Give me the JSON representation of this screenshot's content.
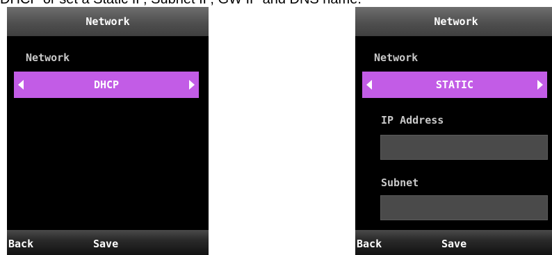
{
  "caption": "DHCP  or set a Static IP, Subnet IP, GW IP and DNS name.",
  "left_screen": {
    "title": "Network",
    "network_label": "Network",
    "mode_value": "DHCP",
    "back_label": "Back",
    "save_label": "Save"
  },
  "right_screen": {
    "title": "Network",
    "network_label": "Network",
    "mode_value": "STATIC",
    "ip_address_label": "IP Address",
    "ip_address_value": "",
    "subnet_label": "Subnet",
    "subnet_value": "",
    "back_label": "Back",
    "save_label": "Save"
  },
  "colors": {
    "selector_bg": "#c25ce6",
    "screen_bg": "#000000",
    "label_text": "#c9c9c9"
  }
}
